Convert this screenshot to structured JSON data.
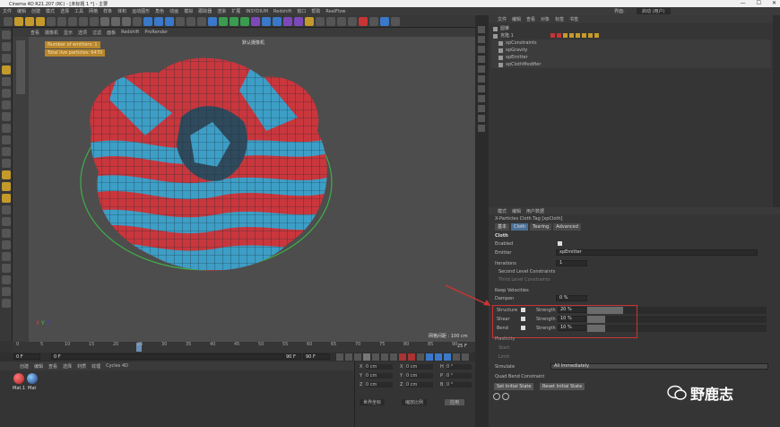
{
  "window": {
    "title": "Cinema 4D R21.207 (RC) - [未标题 1 *] - 主要"
  },
  "menubar": {
    "items": [
      "文件",
      "编辑",
      "创建",
      "模式",
      "选择",
      "工具",
      "网格",
      "样条",
      "体积",
      "运动图形",
      "角色",
      "动画",
      "模拟",
      "跟踪器",
      "渲染",
      "扩展",
      "INSYDIUM",
      "Redshift",
      "窗口",
      "帮助",
      "RealFlow"
    ]
  },
  "layout": {
    "label": "界面:",
    "value": "启动 (用户)"
  },
  "viewport": {
    "menu": [
      "查看",
      "摄像机",
      "显示",
      "选项",
      "过滤",
      "面板",
      "Redshift",
      "ProRender"
    ],
    "camera_label": "默认摄像机",
    "hud_emitters": "Number of emitters: 1",
    "hud_particles": "Total live particles: 6470",
    "grid_info": "网格间距 : 100 cm"
  },
  "timeline": {
    "ticks": [
      "0",
      "5",
      "10",
      "15",
      "20",
      "25",
      "30",
      "35",
      "40",
      "45",
      "50",
      "55",
      "60",
      "65",
      "70",
      "75",
      "80",
      "85",
      "90"
    ],
    "current_frame": "25 F"
  },
  "transport": {
    "start": "0 F",
    "start2": "0 F",
    "end": "90 F",
    "end2": "90 F"
  },
  "materials": {
    "menu": [
      "创建",
      "编辑",
      "查看",
      "选择",
      "材质",
      "纹理",
      "Cycles 4D"
    ],
    "items": [
      "Mat.1",
      "Mat"
    ]
  },
  "coords": {
    "rows": [
      {
        "a": "X",
        "av": "0 cm",
        "b": "X",
        "bv": "0 cm",
        "c": "H",
        "cv": "0 °"
      },
      {
        "a": "Y",
        "av": "0 cm",
        "b": "Y",
        "bv": "0 cm",
        "c": "P",
        "cv": "0 °"
      },
      {
        "a": "Z",
        "av": "0 cm",
        "b": "Z",
        "bv": "0 cm",
        "c": "B",
        "cv": "0 °"
      }
    ],
    "mode": "世界坐标",
    "scale": "缩放比例",
    "apply": "应用"
  },
  "object_manager": {
    "menu": [
      "文件",
      "编辑",
      "查看",
      "对象",
      "标签",
      "书签"
    ],
    "items": [
      {
        "name": "圆锥"
      },
      {
        "name": "克隆.1"
      },
      {
        "name": "xpConstraints"
      },
      {
        "name": "xpGravity"
      },
      {
        "name": "xpEmitter"
      },
      {
        "name": "xpClothModifier"
      }
    ]
  },
  "attributes": {
    "menu": [
      "模式",
      "编辑",
      "用户数据"
    ],
    "title": "X-Particles Cloth Tag [xpCloth]",
    "tabs": [
      "基本",
      "Cloth",
      "Tearing",
      "Advanced"
    ],
    "section": "Cloth",
    "enabled_label": "Enabled",
    "emitter_label": "Emitter",
    "emitter_value": "xpEmitter",
    "iterations_label": "Iterations",
    "iterations_value": "1",
    "second_label": "Second Level Constraints",
    "third_label": "Third Level Constraints",
    "keep_label": "Keep Velocities",
    "dampen_label": "Dampen",
    "dampen_value": "0 %",
    "strength_rows": [
      {
        "label": "Structure",
        "strength_label": "Strength",
        "value": "20 %",
        "fill": 0.2
      },
      {
        "label": "Shear",
        "strength_label": "Strength",
        "value": "10 %",
        "fill": 0.1
      },
      {
        "label": "Bend",
        "strength_label": "Strength",
        "value": "10 %",
        "fill": 0.1
      }
    ],
    "plasticity_label": "Plasticity",
    "start_label": "Start",
    "limit_label": "Limit",
    "simulate_label": "Simulate",
    "simulate_value": "All Immediately",
    "quad_label": "Quad Bend Constraint",
    "set_initial": "Set Initial State",
    "reset_initial": "Reset Initial State"
  },
  "watermark": {
    "text": "野鹿志"
  },
  "colors": {
    "cloth_red": "#c9363c",
    "cloth_blue": "#3d9ec6",
    "highlight": "#c93434",
    "hud": "#b8862c"
  }
}
